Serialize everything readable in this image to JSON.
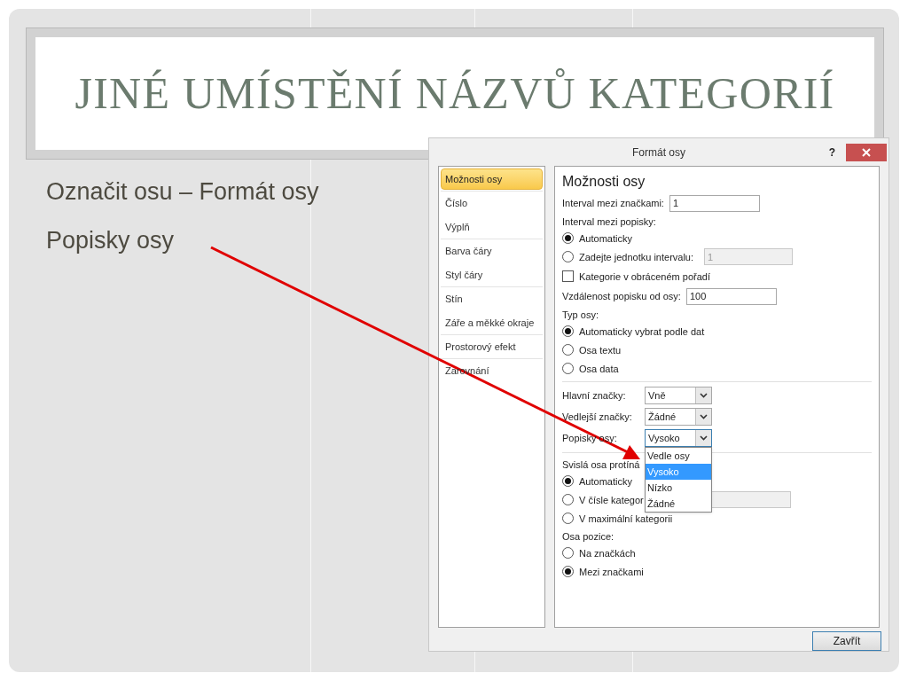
{
  "slide": {
    "title": "JINÉ UMÍSTĚNÍ NÁZVŮ KATEGORIÍ",
    "bullets": [
      "Označit osu – Formát osy",
      "Popisky osy"
    ]
  },
  "dialog": {
    "title": "Formát osy",
    "help": "?",
    "nav": [
      {
        "label": "Možnosti osy",
        "selected": true
      },
      {
        "label": "Číslo",
        "selected": false
      },
      {
        "label": "Výplň",
        "selected": false
      },
      {
        "label": "Barva čáry",
        "selected": false
      },
      {
        "label": "Styl čáry",
        "selected": false
      },
      {
        "label": "Stín",
        "selected": false
      },
      {
        "label": "Záře a měkké okraje",
        "selected": false
      },
      {
        "label": "Prostorový efekt",
        "selected": false
      },
      {
        "label": "Zarovnání",
        "selected": false
      }
    ],
    "panel": {
      "heading": "Možnosti osy",
      "rows": [
        {
          "kind": "field",
          "label": "Interval mezi značkami:",
          "value": "1"
        },
        {
          "kind": "label",
          "text": "Interval mezi popisky:"
        },
        {
          "kind": "radio",
          "label": "Automaticky",
          "selected": true
        },
        {
          "kind": "radio",
          "label": "Zadejte jednotku intervalu:",
          "selected": false,
          "field": {
            "value": "1",
            "disabled": true
          }
        },
        {
          "kind": "checkbox",
          "label": "Kategorie v obráceném pořadí",
          "checked": false
        },
        {
          "kind": "field",
          "label": "Vzdálenost popisku od osy:",
          "value": "100"
        },
        {
          "kind": "label",
          "text": "Typ osy:"
        },
        {
          "kind": "radio",
          "label": "Automaticky vybrat podle dat",
          "selected": true
        },
        {
          "kind": "radio",
          "label": "Osa textu",
          "selected": false
        },
        {
          "kind": "radio",
          "label": "Osa data",
          "selected": false
        },
        {
          "kind": "separator"
        },
        {
          "kind": "select",
          "label": "Hlavní značky:",
          "value": "Vně",
          "open": false
        },
        {
          "kind": "select",
          "label": "Vedlejší značky:",
          "value": "Žádné",
          "open": false
        },
        {
          "kind": "select",
          "label": "Popisky osy:",
          "value": "Vysoko",
          "open": true,
          "options": [
            {
              "label": "Vedle osy",
              "selected": false
            },
            {
              "label": "Vysoko",
              "selected": true
            },
            {
              "label": "Nízko",
              "selected": false
            },
            {
              "label": "Žádné",
              "selected": false
            }
          ]
        },
        {
          "kind": "separator"
        },
        {
          "kind": "label",
          "text": "Svislá osa protíná"
        },
        {
          "kind": "radio",
          "label": "Automaticky",
          "selected": true
        },
        {
          "kind": "radio",
          "label": "V čísle kategor",
          "selected": false,
          "field": {
            "disabled": true
          }
        },
        {
          "kind": "radio",
          "label": "V maximální kategorii",
          "selected": false
        },
        {
          "kind": "label",
          "text": "Osa pozice:"
        },
        {
          "kind": "radio",
          "label": "Na značkách",
          "selected": false
        },
        {
          "kind": "radio",
          "label": "Mezi značkami",
          "selected": true
        }
      ]
    },
    "buttons": [
      "Zavřít"
    ]
  }
}
